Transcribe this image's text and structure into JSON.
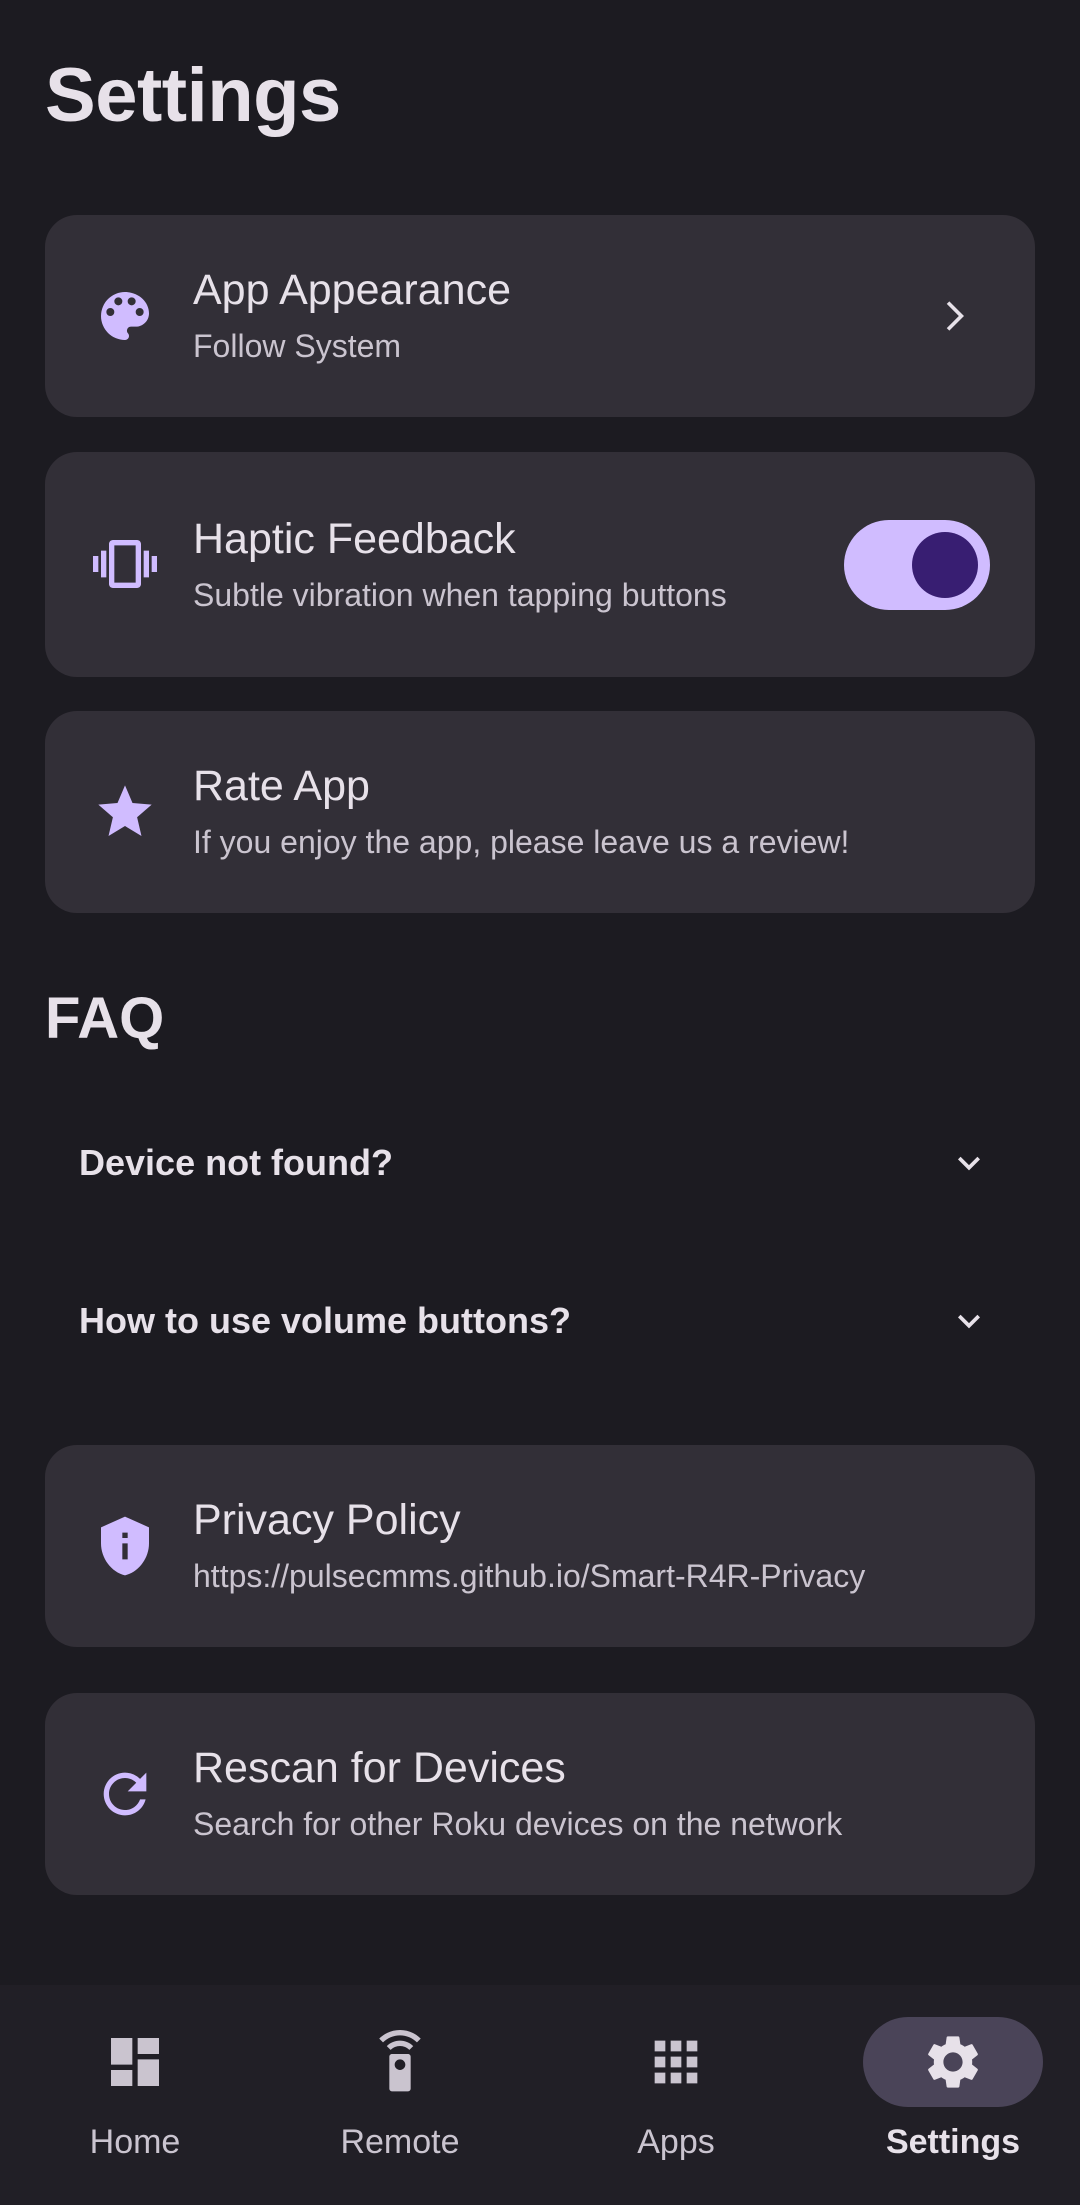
{
  "page_title": "Settings",
  "colors": {
    "background": "#1c1b21",
    "card": "#322f37",
    "accent": "#d0bcff",
    "accent_dark": "#381e72",
    "nav_active_pill": "#4a4458"
  },
  "settings": [
    {
      "icon": "palette-icon",
      "title": "App Appearance",
      "subtitle": "Follow System",
      "trailing": "chevron-right-icon"
    },
    {
      "icon": "vibration-icon",
      "title": "Haptic Feedback",
      "subtitle": "Subtle vibration when tapping buttons",
      "trailing": "toggle",
      "toggle_on": true
    },
    {
      "icon": "star-icon",
      "title": "Rate App",
      "subtitle": "If you enjoy the app, please leave us a review!"
    }
  ],
  "faq": {
    "title": "FAQ",
    "items": [
      {
        "question": "Device not found?"
      },
      {
        "question": "How to use volume buttons?"
      }
    ]
  },
  "links": [
    {
      "icon": "shield-info-icon",
      "title": "Privacy Policy",
      "subtitle": "https://pulsecmms.github.io/Smart-R4R-Privacy"
    },
    {
      "icon": "refresh-icon",
      "title": "Rescan for Devices",
      "subtitle": "Search for other Roku devices on the network"
    }
  ],
  "nav": {
    "items": [
      {
        "label": "Home",
        "icon": "dashboard-icon",
        "active": false
      },
      {
        "label": "Remote",
        "icon": "remote-icon",
        "active": false
      },
      {
        "label": "Apps",
        "icon": "apps-grid-icon",
        "active": false
      },
      {
        "label": "Settings",
        "icon": "gear-icon",
        "active": true
      }
    ]
  }
}
